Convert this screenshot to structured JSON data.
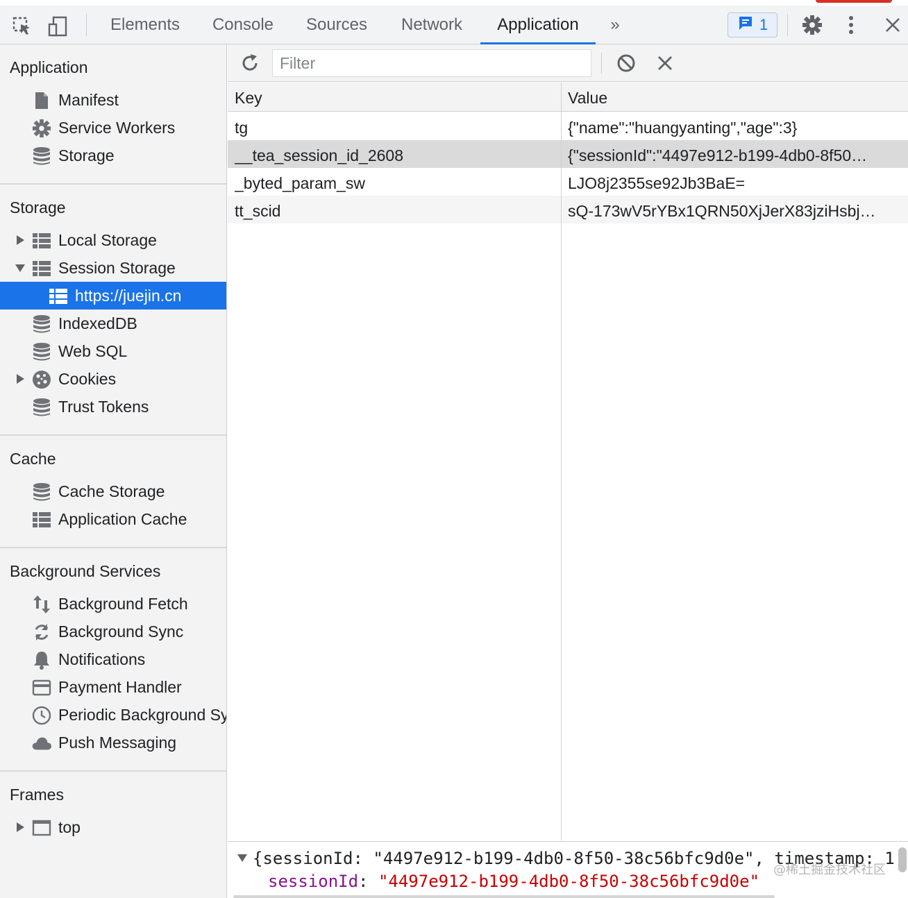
{
  "toolbar": {
    "tabs": [
      "Elements",
      "Console",
      "Sources",
      "Network",
      "Application"
    ],
    "active_tab": "Application",
    "more_tabs_glyph": "»",
    "issues_count": "1",
    "icons": [
      "inspect-element-icon",
      "device-toolbar-icon",
      "chat-bubble-icon",
      "gear-icon",
      "kebab-menu-icon",
      "close-icon"
    ],
    "accent_color": "#1a73e8"
  },
  "sidebar": {
    "application": {
      "title": "Application",
      "items": [
        {
          "label": "Manifest",
          "icon": "document-icon"
        },
        {
          "label": "Service Workers",
          "icon": "gear-icon"
        },
        {
          "label": "Storage",
          "icon": "database-icon"
        }
      ]
    },
    "storage": {
      "title": "Storage",
      "items": [
        {
          "label": "Local Storage",
          "icon": "grid-icon",
          "expander": "collapsed"
        },
        {
          "label": "Session Storage",
          "icon": "grid-icon",
          "expander": "expanded"
        },
        {
          "label": "https://juejin.cn",
          "icon": "grid-icon",
          "selected": true
        },
        {
          "label": "IndexedDB",
          "icon": "database-icon"
        },
        {
          "label": "Web SQL",
          "icon": "database-icon"
        },
        {
          "label": "Cookies",
          "icon": "cookie-icon",
          "expander": "collapsed"
        },
        {
          "label": "Trust Tokens",
          "icon": "database-icon"
        }
      ]
    },
    "cache": {
      "title": "Cache",
      "items": [
        {
          "label": "Cache Storage",
          "icon": "database-icon"
        },
        {
          "label": "Application Cache",
          "icon": "grid-icon"
        }
      ]
    },
    "background_services": {
      "title": "Background Services",
      "items": [
        {
          "label": "Background Fetch",
          "icon": "arrows-updown-icon"
        },
        {
          "label": "Background Sync",
          "icon": "sync-icon"
        },
        {
          "label": "Notifications",
          "icon": "bell-icon"
        },
        {
          "label": "Payment Handler",
          "icon": "card-icon"
        },
        {
          "label": "Periodic Background Sync",
          "icon": "clock-icon"
        },
        {
          "label": "Push Messaging",
          "icon": "cloud-icon"
        }
      ]
    },
    "frames": {
      "title": "Frames",
      "items": [
        {
          "label": "top",
          "icon": "frame-icon",
          "expander": "collapsed"
        }
      ]
    }
  },
  "main": {
    "filter_placeholder": "Filter",
    "columns": {
      "key": "Key",
      "value": "Value"
    },
    "rows": [
      {
        "key": "tg",
        "value": "{\"name\":\"huangyanting\",\"age\":3}"
      },
      {
        "key": "__tea_session_id_2608",
        "value": "{\"sessionId\":\"4497e912-b199-4db0-8f50…",
        "selected": true
      },
      {
        "key": "_byted_param_sw",
        "value": "LJO8j2355se92Jb3BaE="
      },
      {
        "key": "tt_scid",
        "value": "sQ-173wV5rYBx1QRN50XjJerX83jziHsbj…"
      }
    ],
    "preview": {
      "summary": "{sessionId: \"4497e912-b199-4db0-8f50-38c56bfc9d0e\", timestamp: 1",
      "prop_key": "sessionId",
      "prop_sep": ": ",
      "prop_value": "\"4497e912-b199-4db0-8f50-38c56bfc9d0e\""
    },
    "watermark": "@稀土掘金技术社区"
  }
}
